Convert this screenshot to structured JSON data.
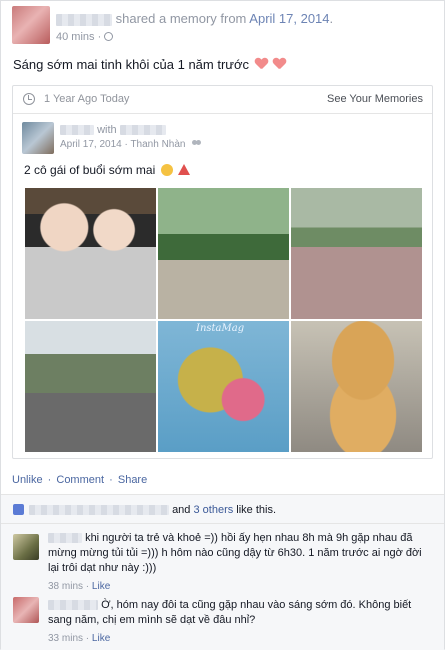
{
  "post": {
    "action_text": "shared a memory from",
    "date": "April 17, 2014",
    "date_suffix": ".",
    "time_ago": "40 mins",
    "separator": "·",
    "audience_icon": "globe-icon",
    "text": "Sáng sớm mai tinh khôi của 1 năm trước"
  },
  "memory": {
    "title": "1 Year Ago Today",
    "see_link": "See Your Memories",
    "inner_with": "with",
    "inner_date": "April 17, 2014",
    "inner_place": "Thanh Nhàn",
    "inner_text": "2 cô gái of buổi sớm mai",
    "photo_watermark": "InstaMag"
  },
  "actions": {
    "unlike": "Unlike",
    "comment": "Comment",
    "share": "Share",
    "dot": "·"
  },
  "likes": {
    "and": "and",
    "others_link": "3 others",
    "suffix": "like this."
  },
  "comments": [
    {
      "text": "khi người ta trẻ và khoẻ =)) hồi ấy hẹn nhau 8h mà 9h gặp nhau đã mừng mừng tủi tủi =))) h hôm nào cũng dậy từ 6h30. 1 năm trước ai ngờ đời lại trôi dạt như này :)))",
      "time": "38 mins",
      "like": "Like"
    },
    {
      "text": "Ờ, hóm nay đôi ta cũng gặp nhau vào sáng sớm đó. Không biết sang năm, chị em mình sẽ dạt về đâu nhỉ?",
      "time": "33 mins",
      "like": "Like"
    }
  ]
}
